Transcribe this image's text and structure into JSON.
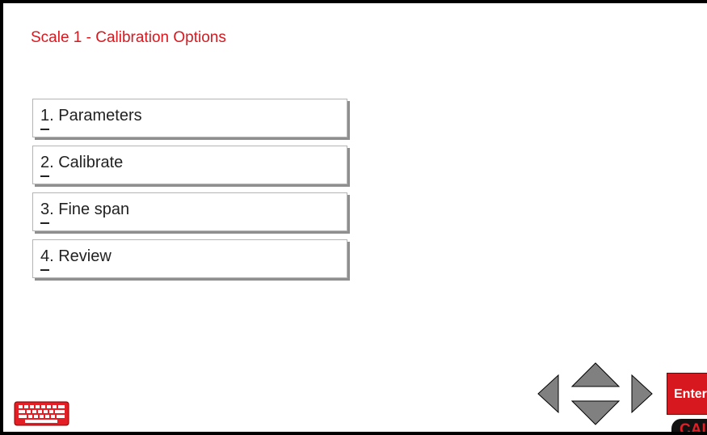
{
  "screen": {
    "title": "Scale 1 - Calibration Options"
  },
  "menu": {
    "items": [
      {
        "num": "1",
        "label": ". Parameters"
      },
      {
        "num": "2",
        "label": ". Calibrate"
      },
      {
        "num": "3",
        "label": ". Fine span"
      },
      {
        "num": "4",
        "label": ". Review"
      }
    ]
  },
  "controls": {
    "enter_label": "Enter",
    "mode_tag": "CAL",
    "keyboard_icon": "keyboard-icon",
    "left_icon": "arrow-left-icon",
    "up_icon": "arrow-up-icon",
    "down_icon": "arrow-down-icon",
    "right_icon": "arrow-right-icon"
  },
  "colors": {
    "accent_red": "#d71920",
    "button_border": "#b4b4b4",
    "button_shadow": "#8f8f8f",
    "arrow_gray": "#808080"
  }
}
